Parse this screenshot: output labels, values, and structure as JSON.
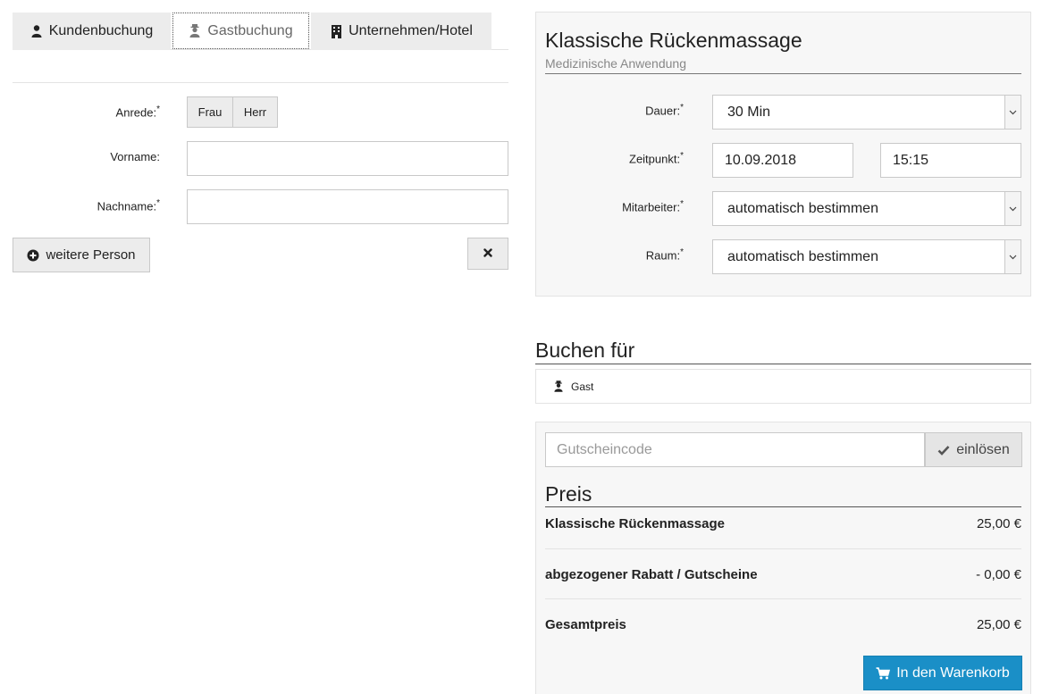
{
  "tabs": [
    {
      "label": "Kundenbuchung",
      "icon": "user-icon"
    },
    {
      "label": "Gastbuchung",
      "icon": "guest-icon",
      "active": true
    },
    {
      "label": "Unternehmen/Hotel",
      "icon": "building-icon"
    }
  ],
  "guest_form": {
    "anrede_label": "Anrede:",
    "vorname_label": "Vorname:",
    "nachname_label": "Nachname:",
    "required_mark": "*",
    "anrede_options": [
      "Frau",
      "Herr"
    ],
    "vorname_value": "",
    "nachname_value": "",
    "add_person_label": "weitere Person",
    "remove_icon": "close-icon"
  },
  "service": {
    "title": "Klassische Rückenmassage",
    "subtitle": "Medizinische Anwendung",
    "dauer_label": "Dauer:",
    "dauer_value": "30 Min",
    "zeitpunkt_label": "Zeitpunkt:",
    "date_value": "10.09.2018",
    "time_value": "15:15",
    "mitarbeiter_label": "Mitarbeiter:",
    "mitarbeiter_value": "automatisch bestimmen",
    "raum_label": "Raum:",
    "raum_value": "automatisch bestimmen"
  },
  "booking_for": {
    "title": "Buchen für",
    "guest_label": "Gast"
  },
  "voucher": {
    "placeholder": "Gutscheincode",
    "button_label": "einlösen"
  },
  "price": {
    "title": "Preis",
    "rows": [
      {
        "name": "Klassische Rückenmassage",
        "amount": "25,00 €"
      },
      {
        "name": "abgezogener Rabatt / Gutscheine",
        "amount": "- 0,00 €"
      },
      {
        "name": "Gesamtpreis",
        "amount": "25,00 €"
      }
    ],
    "cart_button_label": "In den Warenkorb"
  },
  "colors": {
    "accent": "#1a8fc7",
    "panel_bg": "#f7f7f7",
    "tab_bg": "#ececec"
  }
}
